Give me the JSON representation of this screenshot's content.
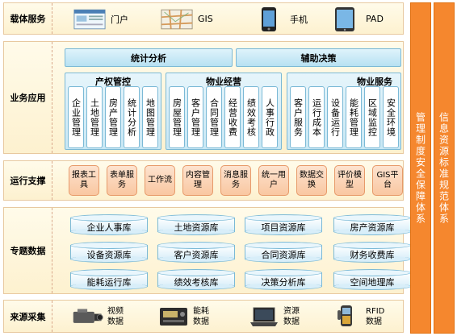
{
  "layers": {
    "carrier": {
      "label": "载体服务",
      "items": [
        {
          "label": "门户",
          "icon": "browser-window-icon"
        },
        {
          "label": "GIS",
          "icon": "map-icon"
        },
        {
          "label": "手机",
          "icon": "mobile-phone-icon"
        },
        {
          "label": "PAD",
          "icon": "tablet-icon"
        }
      ]
    },
    "business": {
      "label": "业务应用",
      "top_left": "统计分析",
      "top_right": "辅助决策",
      "groups": [
        {
          "title": "产权管控",
          "items": [
            "企业管理",
            "土地管理",
            "房产管理",
            "统计分析",
            "地图管理"
          ]
        },
        {
          "title": "物业经营",
          "items": [
            "房屋管理",
            "客户管理",
            "合同管理",
            "经营收费",
            "绩效考核",
            "人事行政"
          ]
        },
        {
          "title": "物业服务",
          "items": [
            "客户服务",
            "运行成本",
            "设备运行",
            "能耗管理",
            "区域监控",
            "安全环境"
          ]
        }
      ]
    },
    "runtime": {
      "label": "运行支撑",
      "items": [
        "报表工具",
        "表单服务",
        "工作流",
        "内容管理",
        "消息服务",
        "统一用户",
        "数据交换",
        "评价模型",
        "GIS平台"
      ]
    },
    "topic": {
      "label": "专题数据",
      "items": [
        "企业人事库",
        "土地资源库",
        "项目资源库",
        "房产资源库",
        "设备资源库",
        "客户资源库",
        "合同资源库",
        "财务收费库",
        "能耗运行库",
        "绩效考核库",
        "决策分析库",
        "空间地理库"
      ]
    },
    "source": {
      "label": "来源采集",
      "items": [
        {
          "label": "视频数据",
          "icon": "camera-icon"
        },
        {
          "label": "能耗数据",
          "icon": "meter-icon"
        },
        {
          "label": "资源数据",
          "icon": "laptop-icon"
        },
        {
          "label": "RFID数据",
          "icon": "rfid-scanner-icon"
        }
      ]
    }
  },
  "side_bars": {
    "management": "管理制度安全保障体系",
    "standards": "信息资源标准规范体系"
  },
  "colors": {
    "layer_bg": "#fdf1cf",
    "blue_box": "#c8e7f4",
    "orange_box": "#f9c7a1",
    "side_bar": "#f5872e"
  }
}
